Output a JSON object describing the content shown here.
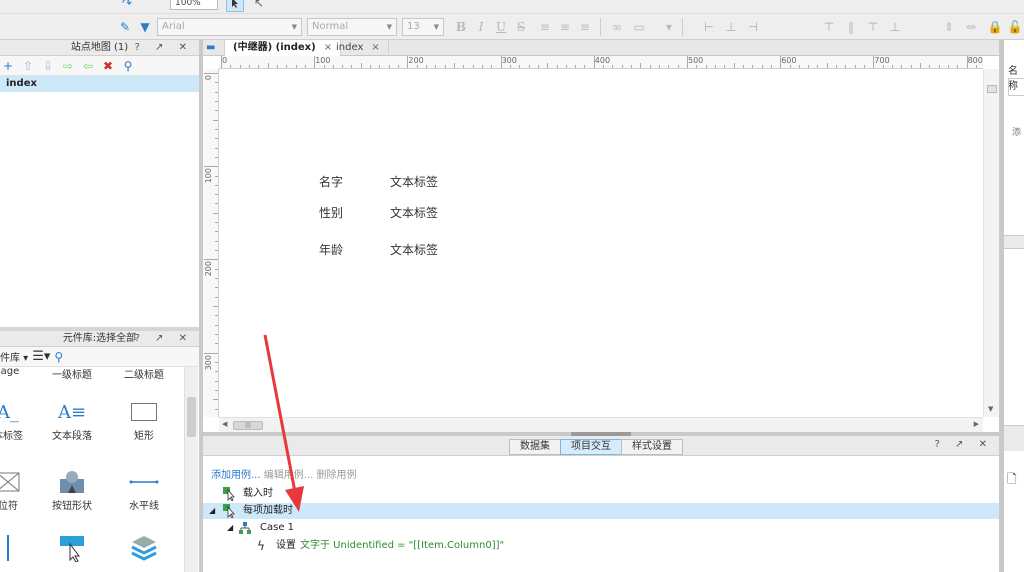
{
  "toolbar": {
    "zoom": "100%",
    "font_family": "Arial",
    "font_style": "Normal",
    "font_size": "13",
    "bold": "B",
    "italic": "I",
    "underline": "U",
    "strike": "S"
  },
  "sitemap": {
    "title": "站点地图 (1)",
    "controls": "? ↗ ✕",
    "items": [
      {
        "label": "index"
      }
    ]
  },
  "library": {
    "title": "元件库:选择全部",
    "controls": "? ↗ ✕",
    "selector": "件库 ▾",
    "items": [
      {
        "label": "age"
      },
      {
        "label": "一级标题"
      },
      {
        "label": "二级标题"
      },
      {
        "label": "本标签"
      },
      {
        "label": "文本段落"
      },
      {
        "label": "矩形"
      },
      {
        "label": "位符"
      },
      {
        "label": "按钮形状"
      },
      {
        "label": "水平线"
      }
    ]
  },
  "canvas": {
    "tabs": [
      {
        "label": "(中继器) (index)",
        "close": "×"
      },
      {
        "label": "index",
        "close": "×"
      }
    ],
    "ruler_h": [
      "0",
      "100",
      "200",
      "300",
      "400",
      "500",
      "600",
      "700",
      "800"
    ],
    "ruler_v": [
      "0",
      "100",
      "200",
      "300"
    ],
    "labels": [
      {
        "key": "名字",
        "value": "文本标签"
      },
      {
        "key": "性别",
        "value": "文本标签"
      },
      {
        "key": "年龄",
        "value": "文本标签"
      }
    ]
  },
  "interactions": {
    "tabs": [
      {
        "label": "数据集"
      },
      {
        "label": "项目交互"
      },
      {
        "label": "样式设置"
      }
    ],
    "controls": "? ↗ ✕",
    "add_case": "添加用例...",
    "edit_case": "编辑用例...",
    "delete_case": "删除用例",
    "events": [
      {
        "label": "载入时"
      },
      {
        "label": "每项加载时"
      }
    ],
    "case": "Case 1",
    "action_prefix": "设置",
    "action_detail": "文字于 Unidentified = \"[[Item.Column0]]\""
  },
  "right_panel": {
    "label1": "名称",
    "label2": "添"
  },
  "colors": {
    "accent": "#2a7cc7",
    "selection": "#cde8f8",
    "arrow": "#e8383d",
    "action_green": "#2e8b2e"
  }
}
